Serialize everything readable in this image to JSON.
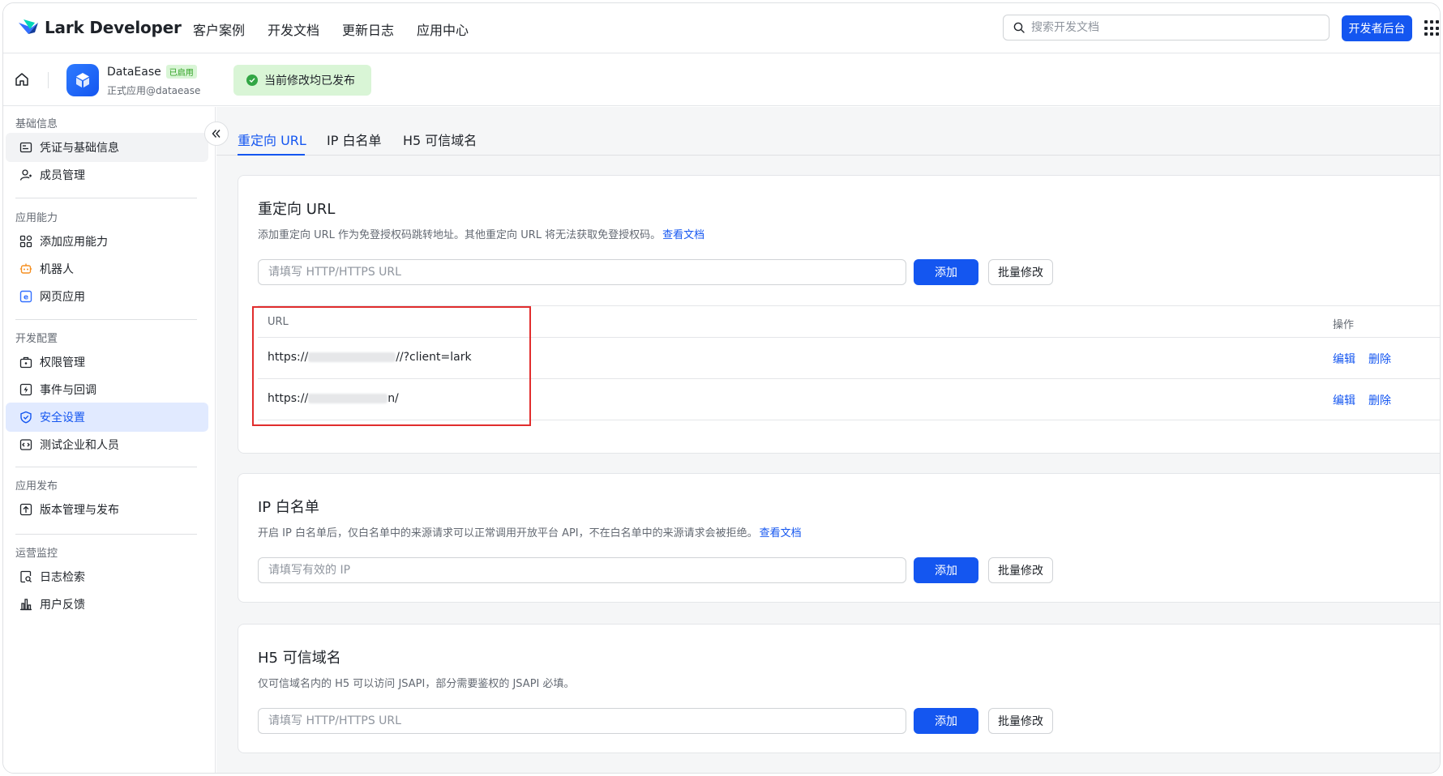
{
  "topnav": {
    "logo_text": "Lark Developer",
    "links": [
      "客户案例",
      "开发文档",
      "更新日志",
      "应用中心"
    ],
    "search_placeholder": "搜索开发文档",
    "console_button": "开发者后台"
  },
  "appbar": {
    "app_name": "DataEase",
    "app_badge": "已启用",
    "app_subtitle": "正式应用@dataease",
    "publish_status": "当前修改均已发布"
  },
  "sidebar": {
    "groups": [
      {
        "title": "基础信息",
        "items": [
          "凭证与基础信息",
          "成员管理"
        ]
      },
      {
        "title": "应用能力",
        "items": [
          "添加应用能力",
          "机器人",
          "网页应用"
        ]
      },
      {
        "title": "开发配置",
        "items": [
          "权限管理",
          "事件与回调",
          "安全设置",
          "测试企业和人员"
        ]
      },
      {
        "title": "应用发布",
        "items": [
          "版本管理与发布"
        ]
      },
      {
        "title": "运营监控",
        "items": [
          "日志检索",
          "用户反馈"
        ]
      }
    ],
    "active_item": "安全设置"
  },
  "tabs": [
    "重定向 URL",
    "IP 白名单",
    "H5 可信域名"
  ],
  "redirect": {
    "title": "重定向 URL",
    "desc": "添加重定向 URL 作为免登授权码跳转地址。其他重定向 URL 将无法获取免登授权码。",
    "doc_link": "查看文档",
    "input_placeholder": "请填写 HTTP/HTTPS URL",
    "add": "添加",
    "bulk": "批量修改",
    "table_header_url": "URL",
    "table_header_op": "操作",
    "rows": [
      {
        "prefix": "https://",
        "suffix": "//?client=lark",
        "edit": "编辑",
        "delete": "删除"
      },
      {
        "prefix": "https://",
        "suffix": "n/",
        "edit": "编辑",
        "delete": "删除"
      }
    ]
  },
  "ip_whitelist": {
    "title": "IP 白名单",
    "desc": "开启 IP 白名单后，仅白名单中的来源请求可以正常调用开放平台 API，不在白名单中的来源请求会被拒绝。",
    "doc_link": "查看文档",
    "input_placeholder": "请填写有效的 IP",
    "add": "添加",
    "bulk": "批量修改"
  },
  "h5_domain": {
    "title": "H5 可信域名",
    "desc": "仅可信域名内的 H5 可以访问 JSAPI，部分需要鉴权的 JSAPI 必填。",
    "input_placeholder": "请填写 HTTP/HTTPS URL",
    "add": "添加",
    "bulk": "批量修改"
  },
  "colors": {
    "primary": "#1456f0",
    "success": "#32a645",
    "highlight_box": "#e12d2d"
  }
}
